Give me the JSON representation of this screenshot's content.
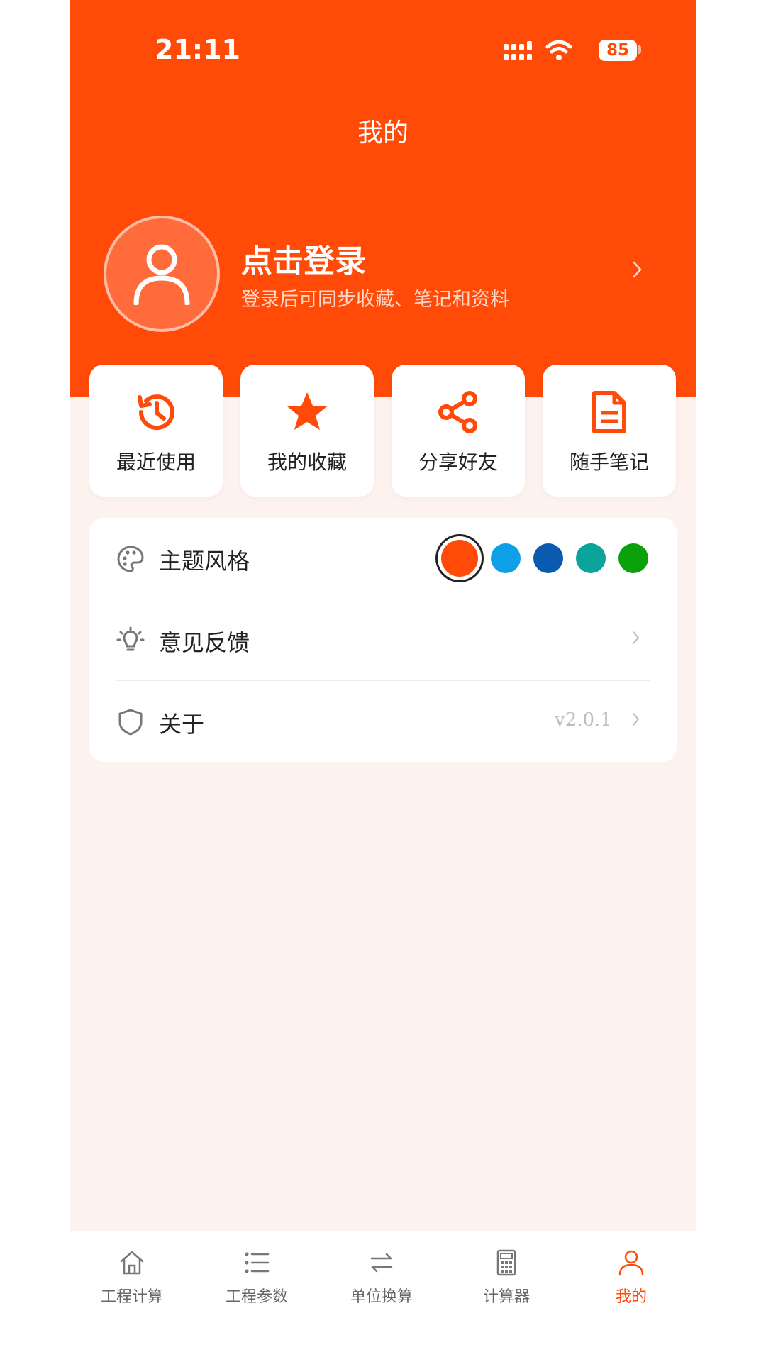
{
  "status_bar": {
    "time": "21:11",
    "battery": "85"
  },
  "header": {
    "title": "我的"
  },
  "profile": {
    "title": "点击登录",
    "subtitle": "登录后可同步收藏、笔记和资料"
  },
  "quick_actions": [
    {
      "label": "最近使用",
      "icon": "history-icon"
    },
    {
      "label": "我的收藏",
      "icon": "star-icon"
    },
    {
      "label": "分享好友",
      "icon": "share-icon"
    },
    {
      "label": "随手笔记",
      "icon": "note-icon"
    }
  ],
  "settings": {
    "theme": {
      "label": "主题风格",
      "colors": [
        "#ff4a08",
        "#0ea0e6",
        "#0a5ab0",
        "#0aa49a",
        "#0aa10a"
      ],
      "selected_color": "#ff4a08"
    },
    "feedback": {
      "label": "意见反馈"
    },
    "about": {
      "label": "关于",
      "version": "v2.0.1"
    }
  },
  "tabs": [
    {
      "label": "工程计算",
      "icon": "home-icon"
    },
    {
      "label": "工程参数",
      "icon": "list-icon"
    },
    {
      "label": "单位换算",
      "icon": "swap-icon"
    },
    {
      "label": "计算器",
      "icon": "calculator-icon"
    },
    {
      "label": "我的",
      "icon": "user-icon",
      "active": true
    }
  ],
  "colors": {
    "accent": "#ff4a08",
    "background": "#fdf2ee"
  }
}
